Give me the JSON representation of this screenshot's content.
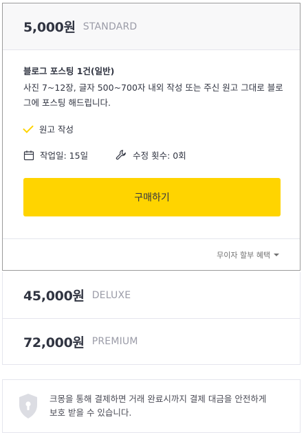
{
  "packages": [
    {
      "price": "5,000원",
      "tier": "STANDARD",
      "title": "블로그 포스팅 1건(일반)",
      "description": "사진 7~12장, 글자 500~700자 내외 작성 또는 주신 원고 그대로 블로그에 포스팅 해드립니다.",
      "feature": "원고 작성",
      "work_days": "작업일: 15일",
      "revisions": "수정 횟수: 0회",
      "buy_label": "구매하기",
      "installment_label": "무이자 할부 혜택"
    },
    {
      "price": "45,000원",
      "tier": "DELUXE"
    },
    {
      "price": "72,000원",
      "tier": "PREMIUM"
    }
  ],
  "notice": {
    "line1": "크몽을 통해 결제하면 거래 완료시까지 결제 대금을 안전하게",
    "line2": "보호 받을 수 있습니다."
  },
  "colors": {
    "accent": "#ffd400",
    "text": "#303441",
    "muted": "#9a9ba7"
  },
  "icons": [
    "check-icon",
    "calendar-icon",
    "wrench-icon",
    "caret-down-icon",
    "shield-lock-icon"
  ]
}
